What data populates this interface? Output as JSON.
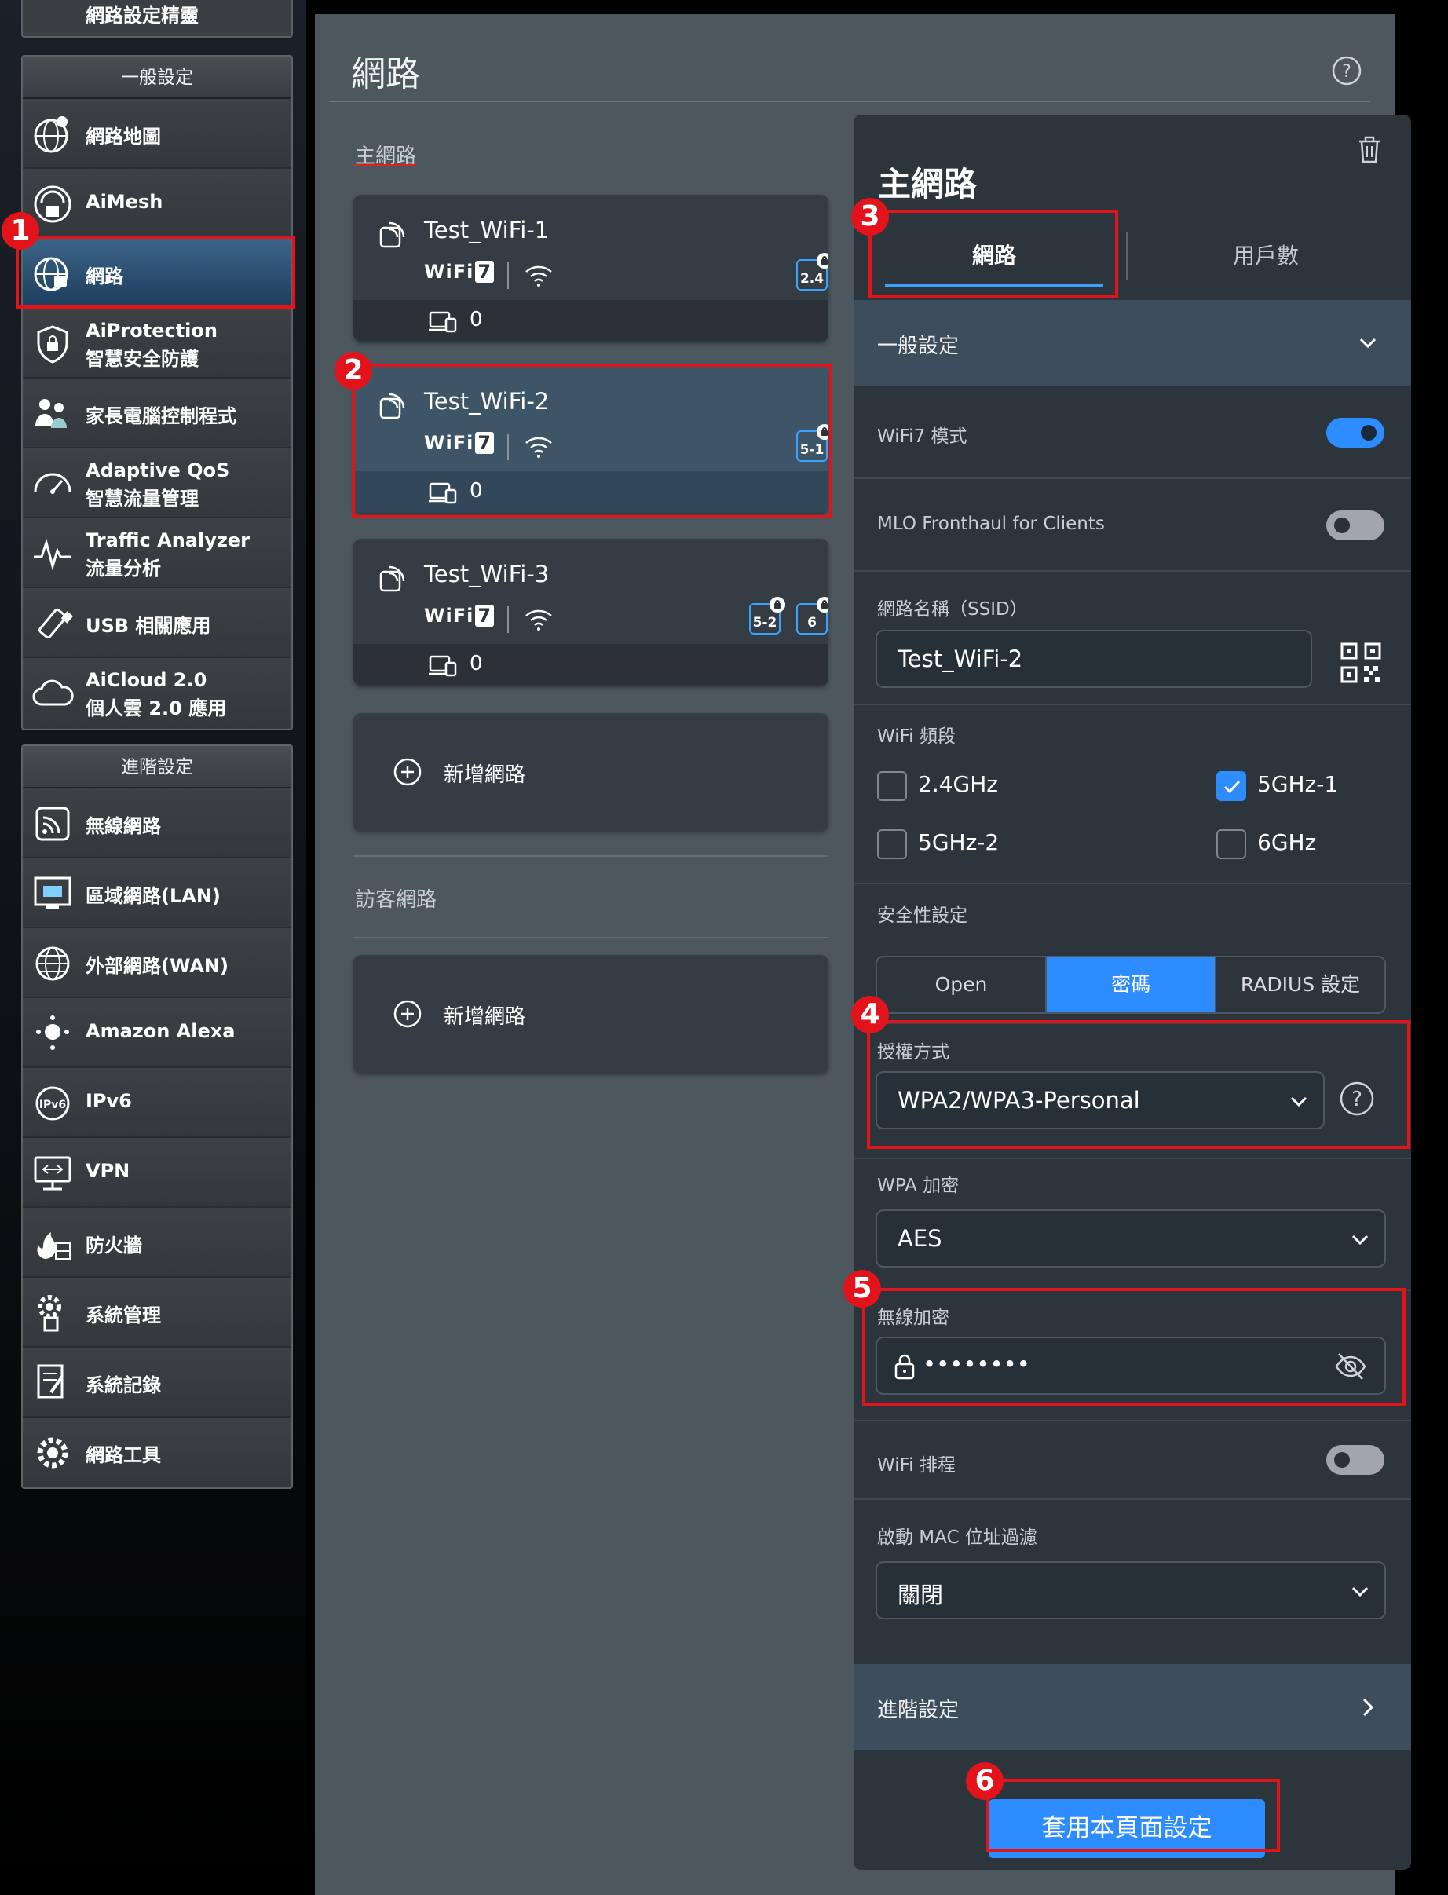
{
  "sidebar": {
    "top_partial_label": "網路設定精靈",
    "general_header": "一般設定",
    "general_items": [
      {
        "label": "網路地圖",
        "icon": "globe-map-icon"
      },
      {
        "label": "AiMesh",
        "icon": "aimesh-icon"
      },
      {
        "label": "網路",
        "icon": "network-globe-icon"
      },
      {
        "label": "AiProtection",
        "label2": "智慧安全防護",
        "icon": "shield-lock-icon"
      },
      {
        "label": "家長電腦控制程式",
        "icon": "family-icon"
      },
      {
        "label": "Adaptive QoS",
        "label2": "智慧流量管理",
        "icon": "speedometer-icon"
      },
      {
        "label": "Traffic Analyzer",
        "label2": "流量分析",
        "icon": "analyzer-icon"
      },
      {
        "label": "USB 相關應用",
        "icon": "usb-icon"
      },
      {
        "label": "AiCloud 2.0",
        "label2": "個人雲 2.0 應用",
        "icon": "cloud-icon"
      }
    ],
    "advanced_header": "進階設定",
    "advanced_items": [
      {
        "label": "無線網路",
        "icon": "wireless-icon"
      },
      {
        "label": "區域網路(LAN)",
        "icon": "lan-icon"
      },
      {
        "label": "外部網路(WAN)",
        "icon": "wan-globe-icon"
      },
      {
        "label": "Amazon Alexa",
        "icon": "alexa-icon"
      },
      {
        "label": "IPv6",
        "icon": "ipv6-icon"
      },
      {
        "label": "VPN",
        "icon": "vpn-icon"
      },
      {
        "label": "防火牆",
        "icon": "firewall-icon"
      },
      {
        "label": "系統管理",
        "icon": "admin-gear-icon"
      },
      {
        "label": "系統記錄",
        "icon": "log-icon"
      },
      {
        "label": "網路工具",
        "icon": "tools-icon"
      }
    ]
  },
  "main": {
    "title": "網路",
    "primary_label": "主網路",
    "networks": [
      {
        "name": "Test_WiFi-1",
        "wifi_label": "WiFi",
        "wifi_gen": "7",
        "bands": [
          "2.4"
        ],
        "clients": "0"
      },
      {
        "name": "Test_WiFi-2",
        "wifi_label": "WiFi",
        "wifi_gen": "7",
        "bands": [
          "5-1"
        ],
        "clients": "0"
      },
      {
        "name": "Test_WiFi-3",
        "wifi_label": "WiFi",
        "wifi_gen": "7",
        "bands": [
          "5-2",
          "6"
        ],
        "clients": "0"
      }
    ],
    "add_network": "新增網路",
    "guest_label": "訪客網路",
    "add_guest_network": "新增網路"
  },
  "panel": {
    "title": "主網路",
    "tabs": [
      "網路",
      "用戶數"
    ],
    "general_section": "一般設定",
    "wifi7_mode_label": "WiFi7 模式",
    "wifi7_mode_on": true,
    "mlo_label": "MLO Fronthaul for Clients",
    "mlo_on": false,
    "ssid_label": "網路名稱（SSID）",
    "ssid_value": "Test_WiFi-2",
    "band_label": "WiFi 頻段",
    "bands": [
      {
        "label": "2.4GHz",
        "checked": false
      },
      {
        "label": "5GHz-1",
        "checked": true
      },
      {
        "label": "5GHz-2",
        "checked": false
      },
      {
        "label": "6GHz",
        "checked": false
      }
    ],
    "security_label": "安全性設定",
    "security_options": [
      "Open",
      "密碼",
      "RADIUS 設定"
    ],
    "security_selected": "密碼",
    "auth_label": "授權方式",
    "auth_value": "WPA2/WPA3-Personal",
    "wpa_label": "WPA 加密",
    "wpa_value": "AES",
    "psk_label": "無線加密",
    "psk_value": "••••••••",
    "schedule_label": "WiFi 排程",
    "schedule_on": false,
    "mac_label": "啟動 MAC 位址過濾",
    "mac_value": "關閉",
    "advanced_label": "進階設定",
    "apply_label": "套用本頁面設定"
  },
  "annotations": [
    "1",
    "2",
    "3",
    "4",
    "5",
    "6"
  ],
  "colors": {
    "accent": "#2d8cff",
    "annotation": "#e3131b",
    "panel": "#2d353c",
    "main": "#4d575e"
  }
}
